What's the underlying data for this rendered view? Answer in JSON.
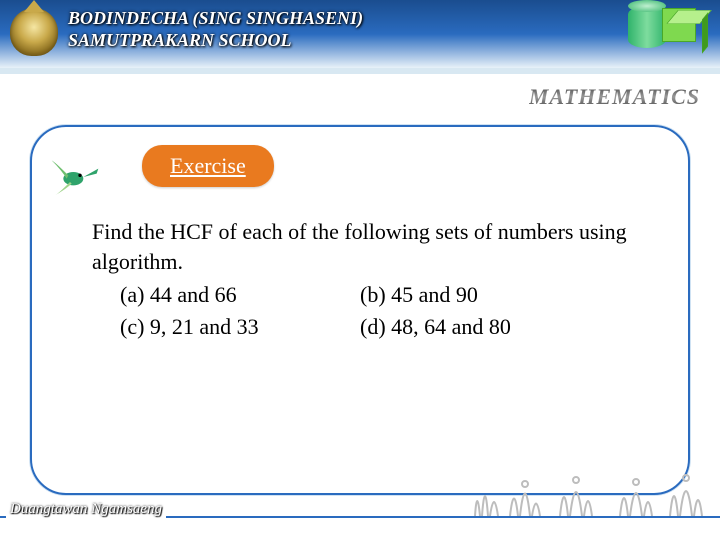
{
  "header": {
    "school_line1": "BODINDECHA  (SING SINGHASENI)",
    "school_line2": "SAMUTPRAKARN  SCHOOL"
  },
  "subject": "MATHEMATICS",
  "badge": "Exercise",
  "question": "Find the HCF of each of the  following sets of numbers  using  algorithm.",
  "options": {
    "a": "(a)  44  and  66",
    "b": "(b)  45 and 90",
    "c": "(c)  9, 21 and 33",
    "d": "(d)  48, 64 and 80"
  },
  "author": "Duangtawan  Ngamsaeng",
  "icons": {
    "crest": "school-crest-icon",
    "cylinder": "cylinder-icon",
    "cube": "cube-icon",
    "bird": "hummingbird-icon",
    "grass": "grass-silhouette-icon"
  },
  "colors": {
    "accent_blue": "#2a6bbf",
    "badge_orange": "#e97a1f",
    "shape_green": "#7fd94f"
  }
}
